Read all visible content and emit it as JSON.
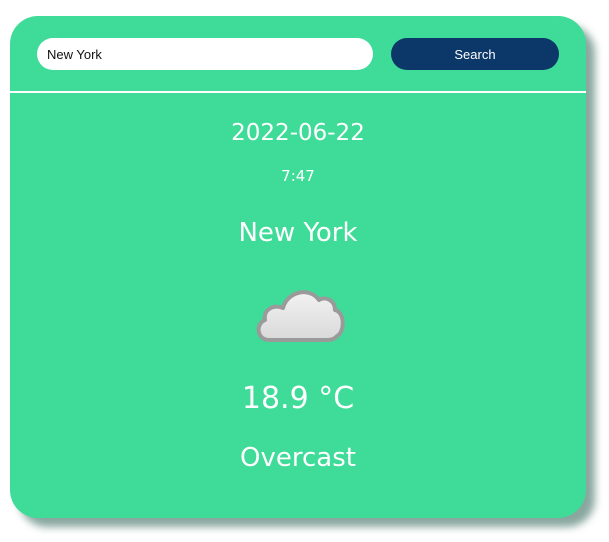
{
  "search": {
    "value": "New York",
    "button_label": "Search"
  },
  "weather": {
    "date": "2022-06-22",
    "time": "7:47",
    "city": "New York",
    "icon": "cloud-icon",
    "temperature": "18.9 °C",
    "condition": "Overcast"
  },
  "colors": {
    "card_background": "#3fdb98",
    "button_background": "#0b3769",
    "text": "#ffffff"
  }
}
